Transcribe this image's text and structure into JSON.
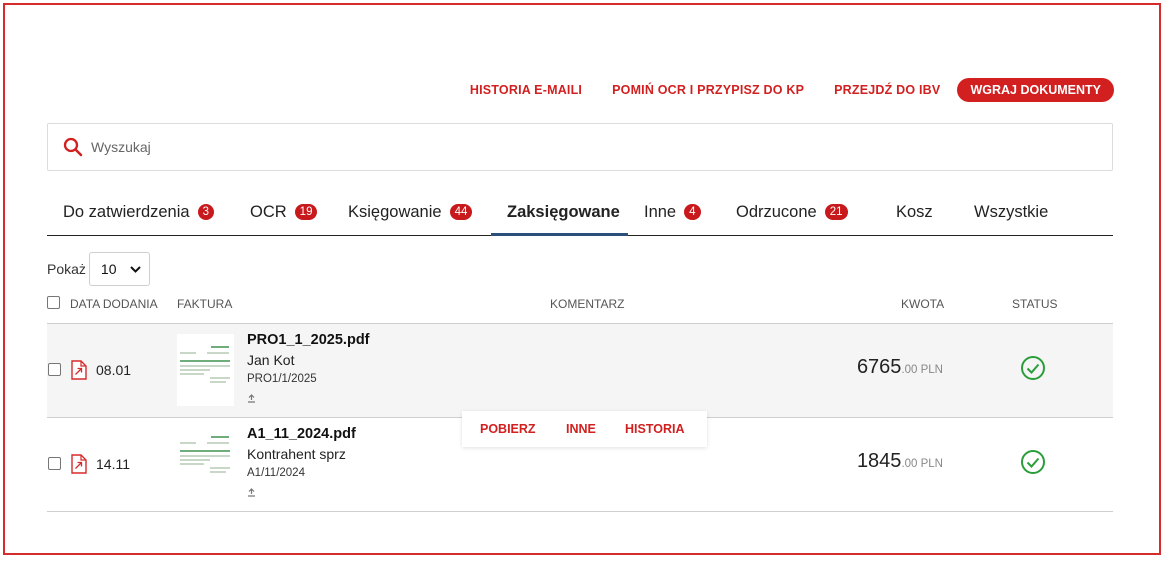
{
  "toolbar": {
    "email_history": "HISTORIA E-MAILI",
    "skip_ocr": "POMIŃ OCR I PRZYPISZ DO KP",
    "go_ibv": "PRZEJDŹ DO IBV",
    "upload": "WGRAJ DOKUMENTY"
  },
  "search": {
    "placeholder": "Wyszukaj",
    "value": ""
  },
  "tabs": [
    {
      "label": "Do zatwierdzenia",
      "count": "3"
    },
    {
      "label": "OCR",
      "count": "19"
    },
    {
      "label": "Księgowanie",
      "count": "44"
    },
    {
      "label": "Zaksięgowane",
      "count": ""
    },
    {
      "label": "Inne",
      "count": "4"
    },
    {
      "label": "Odrzucone",
      "count": "21"
    },
    {
      "label": "Kosz",
      "count": ""
    },
    {
      "label": "Wszystkie",
      "count": ""
    }
  ],
  "active_tab": "Zaksięgowane",
  "page_size": {
    "label": "Pokaż",
    "value": "10"
  },
  "columns": {
    "date": "DATA DODANIA",
    "invoice": "FAKTURA",
    "comment": "KOMENTARZ",
    "amount": "KWOTA",
    "status": "STATUS"
  },
  "rows": [
    {
      "date": "08.01",
      "file": "PRO1_1_2025.pdf",
      "contractor": "Jan Kot",
      "doc_no": "PRO1/1/2025",
      "amount_int": "6765",
      "amount_dec": ".00 PLN",
      "status": "ok"
    },
    {
      "date": "14.11",
      "file": "A1_11_2024.pdf",
      "contractor": "Kontrahent sprz",
      "doc_no": "A1/11/2024",
      "amount_int": "1845",
      "amount_dec": ".00 PLN",
      "status": "ok"
    }
  ],
  "row_actions": {
    "download": "POBIERZ",
    "other": "INNE",
    "history": "HISTORIA"
  },
  "colors": {
    "accent": "#d21f1f",
    "badge": "#c8191c",
    "status_ok": "#2a9d3a",
    "tab_underline": "#2a4f7a"
  }
}
